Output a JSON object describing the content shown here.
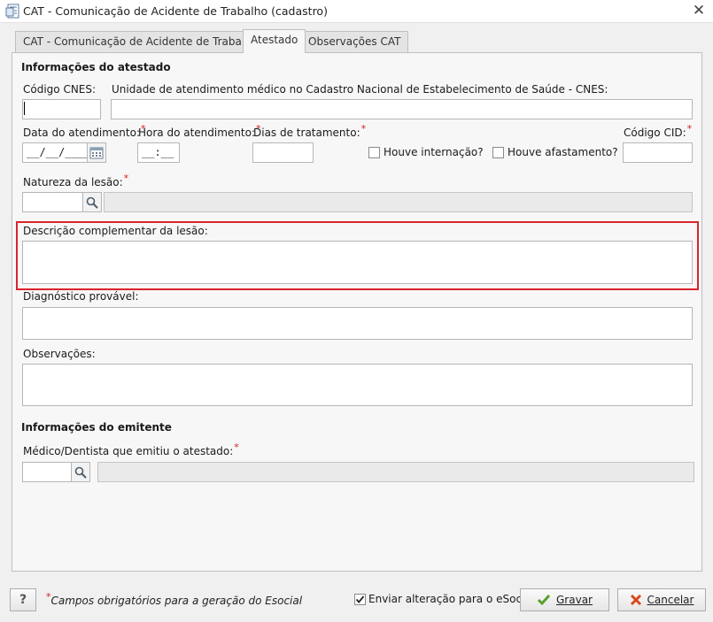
{
  "window": {
    "title": "CAT - Comunicação de Acidente de Trabalho (cadastro)",
    "close_glyph": "✕"
  },
  "tabs": [
    {
      "label": "CAT - Comunicação de Acidente de Trabalho",
      "active": false
    },
    {
      "label": "Atestado",
      "active": true
    },
    {
      "label": "Observações CAT",
      "active": false
    }
  ],
  "atestado": {
    "section_title": "Informações do atestado",
    "codigo_cnes_label": "Código CNES:",
    "codigo_cnes_value": "",
    "unidade_label": "Unidade de atendimento médico no Cadastro Nacional de Estabelecimento de Saúde - CNES:",
    "unidade_value": "",
    "data_atendimento_label": "Data do atendimento:",
    "data_atendimento_value": "__/__/____",
    "hora_atendimento_label": "Hora do atendimento:",
    "hora_atendimento_value": "__:__",
    "dias_tratamento_label": "Dias de tratamento:",
    "dias_tratamento_value": "",
    "houve_internacao_label": "Houve internação?",
    "houve_internacao_checked": false,
    "houve_afastamento_label": "Houve afastamento?",
    "houve_afastamento_checked": false,
    "codigo_cid_label": "Código CID:",
    "codigo_cid_value": "",
    "natureza_label": "Natureza da lesão:",
    "natureza_code": "",
    "natureza_desc": "",
    "descricao_label": "Descrição complementar da lesão:",
    "descricao_value": "",
    "diagnostico_label": "Diagnóstico provável:",
    "diagnostico_value": "",
    "observacoes_label": "Observações:",
    "observacoes_value": ""
  },
  "emitente": {
    "section_title": "Informações do emitente",
    "medico_label": "Médico/Dentista que emitiu o atestado:",
    "medico_code": "",
    "medico_name": ""
  },
  "required_marker": "*",
  "footer": {
    "help_label": "?",
    "required_note": "Campos obrigatórios para a geração do Esocial",
    "enviar_label": "Enviar alteração para o eSocial",
    "enviar_checked": true,
    "gravar_label": "Gravar",
    "cancelar_label": "Cancelar"
  },
  "colors": {
    "required": "#d42020",
    "highlight": "#d9232d",
    "gravar_icon": "#5aa02c",
    "cancelar_icon": "#d9471b"
  },
  "icons": {
    "window": "form-icon",
    "calendar": "calendar-icon",
    "search": "search-icon",
    "check": "checkmark-icon",
    "cancel": "x-icon"
  }
}
